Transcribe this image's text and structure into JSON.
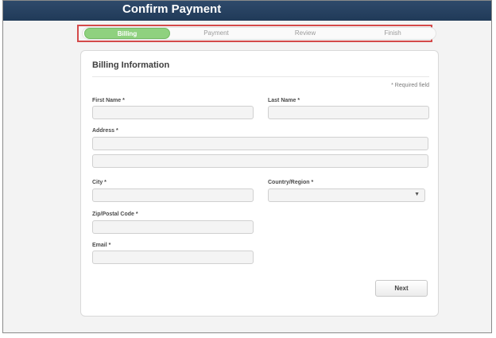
{
  "header": {
    "title": "Confirm Payment"
  },
  "steps": [
    {
      "label": "Billing",
      "active": true
    },
    {
      "label": "Payment",
      "active": false
    },
    {
      "label": "Review",
      "active": false
    },
    {
      "label": "Finish",
      "active": false
    }
  ],
  "form": {
    "section_title": "Billing Information",
    "required_note": "* Required field",
    "first_name_label": "First Name *",
    "last_name_label": "Last Name *",
    "address_label": "Address *",
    "city_label": "City *",
    "country_label": "Country/Region *",
    "zip_label": "Zip/Postal Code *",
    "email_label": "Email *",
    "next_button": "Next"
  },
  "colors": {
    "header_bg": "#2f4a6b",
    "active_step": "#8fd17f",
    "highlight_outline": "#d44a4a"
  }
}
